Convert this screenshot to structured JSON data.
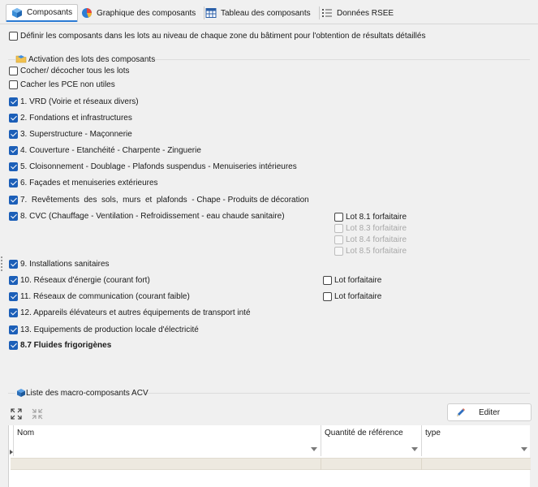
{
  "tabs": [
    {
      "label": "Composants",
      "icon": "cube-icon",
      "active": true
    },
    {
      "label": "Graphique des composants",
      "icon": "pie-chart-icon",
      "active": false
    },
    {
      "label": "Tableau des composants",
      "icon": "table-icon",
      "active": false
    },
    {
      "label": "Données RSEE",
      "icon": "list-icon",
      "active": false
    }
  ],
  "options": {
    "zone_label": "Définir les composants dans les lots au niveau de chaque zone du bâtiment pour l'obtention de résultats détaillés",
    "zone_checked": false
  },
  "activation": {
    "group_title": "Activation des lots des composants",
    "toggle_all": "Cocher/ décocher tous les lots",
    "hide_unused": "Cacher les PCE non utiles",
    "lots": [
      {
        "label": "1. VRD (Voirie et réseaux divers)",
        "checked": true
      },
      {
        "label": "2. Fondations et infrastructures",
        "checked": true
      },
      {
        "label": "3. Superstructure - Maçonnerie",
        "checked": true
      },
      {
        "label": "4. Couverture - Etanchéité - Charpente - Zinguerie",
        "checked": true
      },
      {
        "label": "5. Cloisonnement - Doublage - Plafonds suspendus - Menuiseries intérieures",
        "checked": true
      },
      {
        "label": "6. Façades et menuiseries extérieures",
        "checked": true
      },
      {
        "label": "7.  Revêtements  des  sols,  murs  et  plafonds  - Chape - Produits de décoration",
        "checked": true
      },
      {
        "label": "8. CVC (Chauffage - Ventilation - Refroidissement - eau chaude sanitaire)",
        "checked": true
      },
      {
        "label": "9. Installations sanitaires",
        "checked": true
      },
      {
        "label": "10. Réseaux d'énergie (courant fort)",
        "checked": true
      },
      {
        "label": "11. Réseaux de communication (courant faible)",
        "checked": true
      },
      {
        "label": "12. Appareils élévateurs et autres équipements de transport inté",
        "checked": true
      },
      {
        "label": "13. Equipements de production locale d'électricité",
        "checked": true
      },
      {
        "label": "8.7 Fluides frigorigènes",
        "checked": true
      }
    ],
    "cvc_forfaits": [
      {
        "label": "Lot 8.1 forfaitaire",
        "enabled": true
      },
      {
        "label": "Lot 8.3 forfaitaire",
        "enabled": false
      },
      {
        "label": "Lot 8.4 forfaitaire",
        "enabled": false
      },
      {
        "label": "Lot 8.5 forfaitaire",
        "enabled": false
      }
    ],
    "lot10_forfait": "Lot forfaitaire",
    "lot11_forfait": "Lot forfaitaire"
  },
  "macro": {
    "group_title": "Liste des macro-composants ACV",
    "edit_button": "Editer",
    "columns": [
      "Nom",
      "Quantité de référence",
      "type"
    ]
  }
}
